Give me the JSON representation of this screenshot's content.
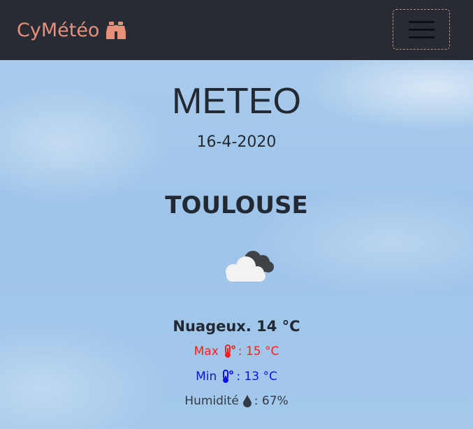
{
  "navbar": {
    "brand": "CyMétéo",
    "brand_icon": "binoculars-icon",
    "toggler_icon": "hamburger-menu-icon",
    "brand_color": "#e8907a",
    "background": "#272b33"
  },
  "main": {
    "title": "METEO",
    "date": "16-4-2020",
    "city": "TOULOUSE",
    "weather_icon": "cloudy-icon",
    "condition": "Nuageux. 14 °C",
    "max_label": "Max",
    "max_value": ": 15 °C",
    "max_color": "#ff1b1b",
    "min_label": "Min",
    "min_value": ": 13 °C",
    "min_color": "#1010e6",
    "humidity_label": "Humidité",
    "humidity_value": ": 67%",
    "thermometer_icon": "thermometer-icon",
    "humidity_icon": "water-drop-icon"
  }
}
